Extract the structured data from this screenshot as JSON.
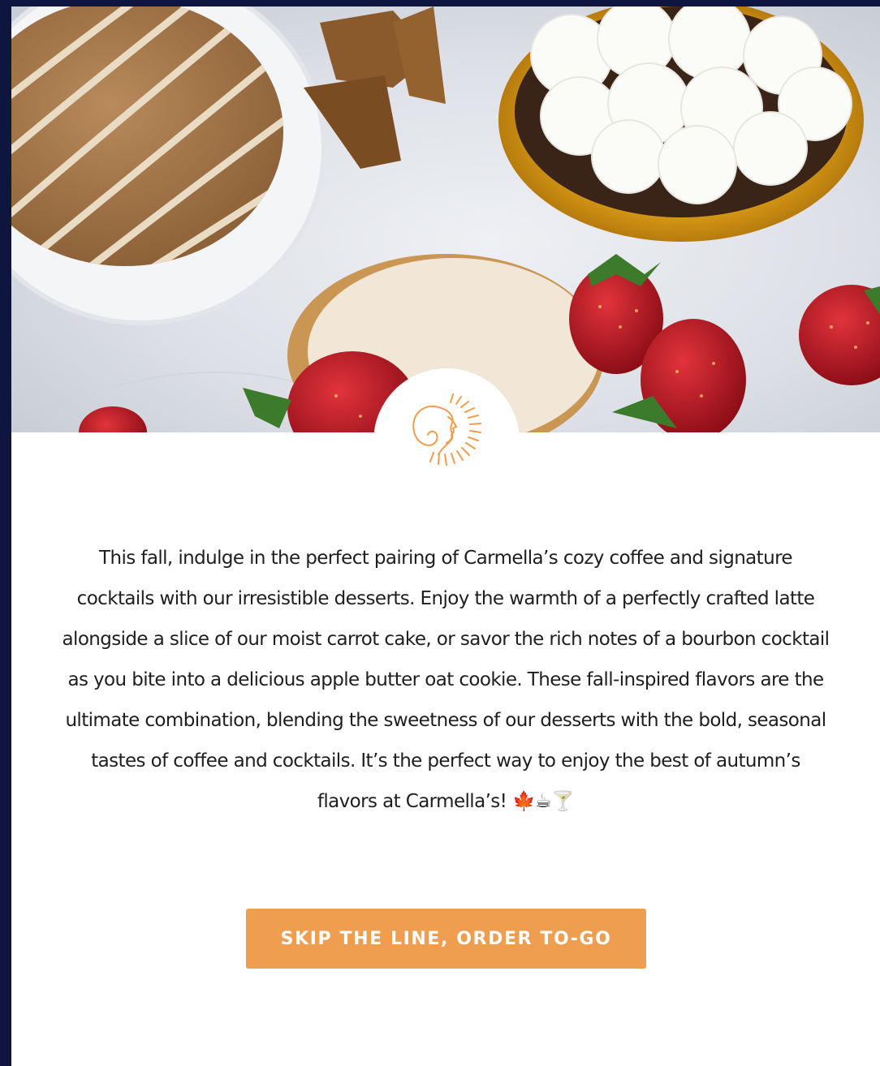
{
  "hero": {
    "image_icon": "dessert-spread-image"
  },
  "logo": {
    "icon": "carmellas-sun-logo-icon",
    "color": "#ef9d4e"
  },
  "body_copy": {
    "text": "This fall, indulge in the perfect pairing of Carmella’s cozy coffee and signature cocktails with our irresistible desserts. Enjoy the warmth of a perfectly crafted latte alongside a slice of our moist carrot cake, or savor the rich notes of a bourbon cocktail as you bite into a delicious apple butter oat cookie. These fall-inspired flavors are the ultimate combination, blending the sweetness of our desserts with the bold, seasonal tastes of coffee and cocktails. It’s the perfect way to enjoy the best of autumn’s flavors at Carmella’s! 🍁☕🍸"
  },
  "cta": {
    "label": "SKIP THE LINE, ORDER TO-GO",
    "color": "#ef9d4e"
  },
  "colors": {
    "page_background": "#0e1640",
    "card_background": "#ffffff",
    "text": "#1e1e1e"
  }
}
